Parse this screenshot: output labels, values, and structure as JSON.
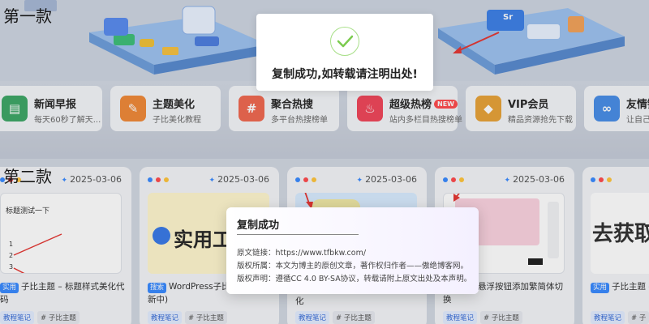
{
  "section1": {
    "title": "第一款",
    "banner_sign": "Sr",
    "cards": [
      {
        "icon": "newspaper-icon",
        "color": "#3fa868",
        "title": "新闻早报",
        "desc": "每天60秒了解天..."
      },
      {
        "icon": "wand-icon",
        "color": "#f08a3a",
        "title": "主题美化",
        "desc": "子比美化教程"
      },
      {
        "icon": "hash-icon",
        "color": "#f06a52",
        "title": "聚合热搜",
        "desc": "多平台热搜榜单"
      },
      {
        "icon": "flame-icon",
        "color": "#f0485c",
        "title": "超级热榜",
        "badge": "NEW",
        "desc": "站内多栏目热搜榜单"
      },
      {
        "icon": "diamond-icon",
        "color": "#e8a33a",
        "title": "VIP会员",
        "desc": "精品资源抢先下载"
      },
      {
        "icon": "link-icon",
        "color": "#4a8fe8",
        "title": "友情链",
        "desc": "让自己..."
      }
    ]
  },
  "section2": {
    "title": "第二款",
    "cards": [
      {
        "date": "2025-03-06",
        "thumb_text": "标题测试一下",
        "thumb_nums": [
          "1",
          "2",
          "3"
        ],
        "tag": "实用",
        "title": "子比主题 – 标题样式美化代码",
        "tags": [
          "教程笔记",
          "# 子比主题"
        ]
      },
      {
        "date": "2025-03-06",
        "thumb_text": "实用工",
        "tag": "搜索",
        "title": "WordPress子比美化...续更新中)",
        "tags": [
          "教程笔记",
          "# 子比主题"
        ]
      },
      {
        "date": "2025-03-06",
        "thumb_text": "",
        "tag": "",
        "title": "化",
        "tags": [
          "教程笔记",
          "# 子比主题"
        ]
      },
      {
        "date": "2025-03-06",
        "thumb_text": "",
        "tag": "",
        "title": "...主题 – 悬浮按钮添加繁简体切换",
        "tags": [
          "教程笔记",
          "# 子比主题"
        ]
      },
      {
        "date": "",
        "thumb_text": "去获取",
        "tag": "实用",
        "title": "子比主题 – 首...滚动公告",
        "tags": [
          "教程笔记",
          "# 子"
        ]
      }
    ]
  },
  "toast": {
    "message": "复制成功,如转载请注明出处!",
    "check_color": "#7ccb4f"
  },
  "modal": {
    "title": "复制成功",
    "rows": [
      "原文链接：https://www.tfbkw.com/",
      "版权所属：本文为博主的原创文章，著作权归作者——傲绝博客网。",
      "版权声明：遵循CC 4.0 BY-SA协议，转载请附上原文出处及本声明。"
    ]
  },
  "colors": {
    "dot_blue": "#3b8bff",
    "dot_red": "#ff4d4f",
    "dot_yellow": "#ffc53d",
    "arrow_red": "#e53935"
  }
}
